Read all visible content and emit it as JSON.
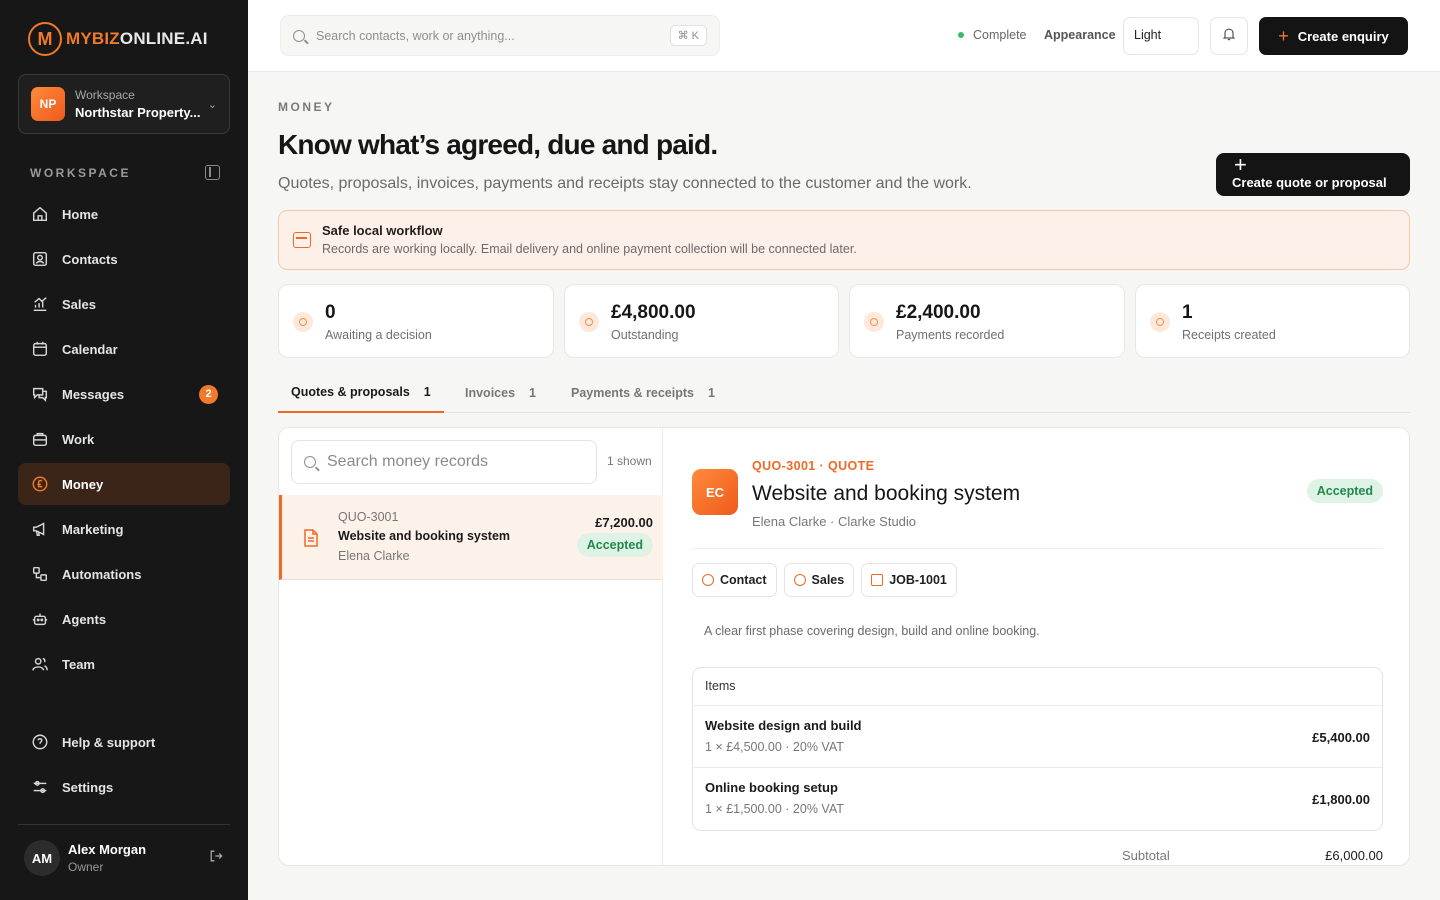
{
  "brand": {
    "logo_letter": "M",
    "name_accent": "MYBIZ",
    "name_rest": "ONLINE.AI",
    "accent_color": "#f07a2b"
  },
  "workspace": {
    "initials": "NP",
    "label": "Workspace",
    "name": "Northstar Property..."
  },
  "sidebar": {
    "section_label": "WORKSPACE",
    "items": [
      {
        "label": "Home",
        "icon": "home-icon"
      },
      {
        "label": "Contacts",
        "icon": "contacts-icon"
      },
      {
        "label": "Sales",
        "icon": "chart-icon"
      },
      {
        "label": "Calendar",
        "icon": "calendar-icon"
      },
      {
        "label": "Messages",
        "icon": "chat-icon",
        "badge": "2"
      },
      {
        "label": "Work",
        "icon": "briefcase-icon"
      },
      {
        "label": "Money",
        "icon": "pound-icon",
        "active": true
      },
      {
        "label": "Marketing",
        "icon": "megaphone-icon"
      },
      {
        "label": "Automations",
        "icon": "flow-icon"
      },
      {
        "label": "Agents",
        "icon": "robot-icon"
      },
      {
        "label": "Team",
        "icon": "team-icon"
      }
    ],
    "bottom_items": [
      {
        "label": "Help & support",
        "icon": "help-icon"
      },
      {
        "label": "Settings",
        "icon": "settings-icon"
      }
    ],
    "user": {
      "initials": "AM",
      "name": "Alex Morgan",
      "role": "Owner"
    }
  },
  "topbar": {
    "search_placeholder": "Search contacts, work or anything...",
    "shortcut": "⌘ K",
    "status": "Complete",
    "appearance_label": "Appearance",
    "theme_value": "Light",
    "create_enquiry": "Create enquiry"
  },
  "page": {
    "eyebrow": "MONEY",
    "title": "Know what’s agreed, due and paid.",
    "subtitle": "Quotes, proposals, invoices, payments and receipts stay connected to the customer and the work.",
    "create_quote": "Create quote or proposal"
  },
  "notice": {
    "title": "Safe local workflow",
    "text": "Records are working locally. Email delivery and online payment collection will be connected later."
  },
  "stats": [
    {
      "value": "0",
      "label": "Awaiting a decision"
    },
    {
      "value": "£4,800.00",
      "label": "Outstanding"
    },
    {
      "value": "£2,400.00",
      "label": "Payments recorded"
    },
    {
      "value": "1",
      "label": "Receipts created"
    }
  ],
  "tabs": [
    {
      "label": "Quotes & proposals",
      "count": "1",
      "active": true
    },
    {
      "label": "Invoices",
      "count": "1"
    },
    {
      "label": "Payments & receipts",
      "count": "1"
    }
  ],
  "list": {
    "search_placeholder": "Search money records",
    "shown": "1 shown",
    "records": [
      {
        "id": "QUO-3001",
        "title": "Website and booking system",
        "contact": "Elena Clarke",
        "amount": "£7,200.00",
        "status": "Accepted"
      }
    ]
  },
  "detail": {
    "initials": "EC",
    "kicker": "QUO-3001 · QUOTE",
    "title": "Website and booking system",
    "subtitle": "Elena Clarke · Clarke Studio",
    "status": "Accepted",
    "chips": [
      {
        "label": "Contact"
      },
      {
        "label": "Sales"
      },
      {
        "label": "JOB-1001"
      }
    ],
    "description": "A clear first phase covering design, build and online booking.",
    "items_header": "Items",
    "items": [
      {
        "name": "Website design and build",
        "meta": "1 × £4,500.00 · 20% VAT",
        "amount": "£5,400.00"
      },
      {
        "name": "Online booking setup",
        "meta": "1 × £1,500.00 · 20% VAT",
        "amount": "£1,800.00"
      }
    ],
    "subtotal_label": "Subtotal",
    "subtotal_value": "£6,000.00"
  }
}
